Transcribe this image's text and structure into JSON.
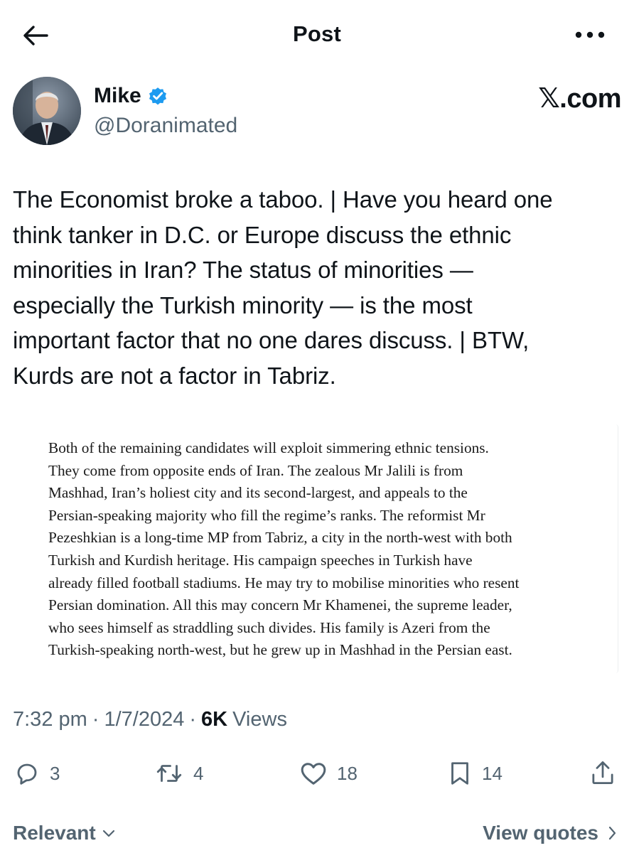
{
  "header": {
    "title": "Post",
    "back_icon": "arrow-left-icon",
    "more_icon": "more-horizontal-icon"
  },
  "author": {
    "name": "Mike",
    "handle": "@Doranimated",
    "verified_color": "#1d9bf0",
    "watermark": "𝕏.com"
  },
  "post": {
    "lines": [
      "The Economist broke a taboo. | Have you heard one",
      "think tanker in D.C. or Europe discuss the ethnic",
      "minorities in Iran? The status of minorities —",
      "especially the Turkish minority — is the most",
      "important factor that no one dares discuss. | BTW,",
      "Kurds are not a factor in Tabriz."
    ]
  },
  "media": {
    "lines": [
      "Both of the remaining candidates will exploit simmering ethnic tensions.",
      "They come from opposite ends of Iran. The zealous Mr Jalili is from",
      "Mashhad, Iran’s holiest city and its second-largest, and appeals to the",
      "Persian-speaking majority who fill the regime’s ranks. The reformist Mr",
      "Pezeshkian is a long-time MP from Tabriz, a city in the north-west with both",
      "Turkish and Kurdish heritage. His campaign speeches in Turkish have",
      "already filled football stadiums. He may try to mobilise minorities who resent",
      "Persian domination. All this may concern Mr Khamenei, the supreme leader,",
      "who sees himself as straddling such divides. His family is Azeri from the",
      "Turkish-speaking north-west, but he grew up in Mashhad in the Persian east."
    ]
  },
  "meta": {
    "time": "7:32 pm",
    "separator": "·",
    "date": "1/7/2024",
    "views_count": "6K",
    "views_label": "Views"
  },
  "actions": {
    "replies": "3",
    "reposts": "4",
    "likes": "18",
    "bookmarks": "14"
  },
  "bottom": {
    "sort_label": "Relevant",
    "quotes_label": "View quotes"
  }
}
